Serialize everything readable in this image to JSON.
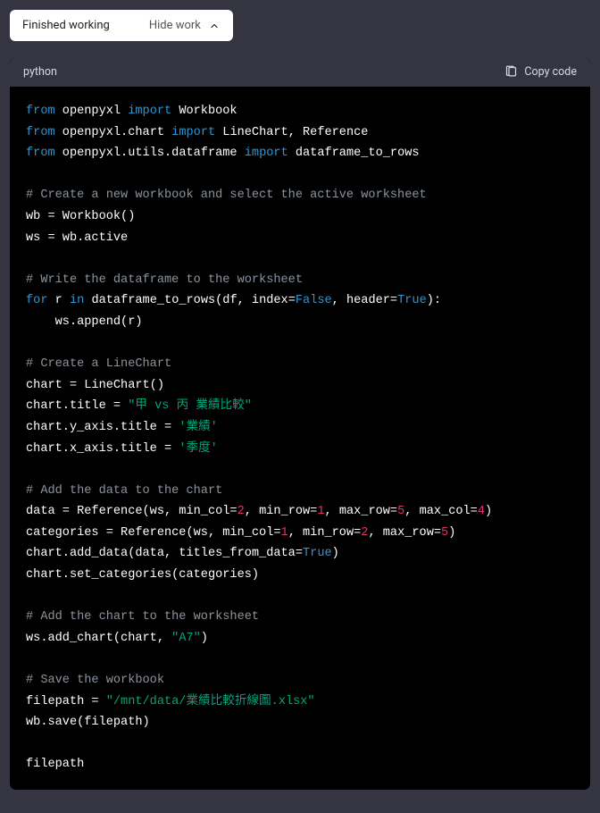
{
  "pill": {
    "status": "Finished working",
    "hide": "Hide work"
  },
  "header": {
    "language": "python",
    "copy": "Copy code"
  },
  "c": {
    "l1_from": "from",
    "l1_mod": " openpyxl ",
    "l1_imp": "import",
    "l1_rest": " Workbook",
    "l2_from": "from",
    "l2_mod": " openpyxl.chart ",
    "l2_imp": "import",
    "l2_rest": " LineChart, Reference",
    "l3_from": "from",
    "l3_mod": " openpyxl.utils.dataframe ",
    "l3_imp": "import",
    "l3_rest": " dataframe_to_rows",
    "blank": "",
    "cmt1": "# Create a new workbook and select the active worksheet",
    "l5": "wb = Workbook()",
    "l6": "ws = wb.active",
    "cmt2": "# Write the dataframe to the worksheet",
    "l8_for": "for",
    "l8_a": " r ",
    "l8_in": "in",
    "l8_b": " dataframe_to_rows(df, index=",
    "l8_false": "False",
    "l8_c": ", header=",
    "l8_true": "True",
    "l8_d": "):",
    "l9": "    ws.append(r)",
    "cmt3": "# Create a LineChart",
    "l11": "chart = LineChart()",
    "l12_a": "chart.title = ",
    "l12_s": "\"甲 vs 丙 業績比較\"",
    "l13_a": "chart.y_axis.title = ",
    "l13_s": "'業績'",
    "l14_a": "chart.x_axis.title = ",
    "l14_s": "'季度'",
    "cmt4": "# Add the data to the chart",
    "l16_a": "data = Reference(ws, min_col=",
    "l16_n1": "2",
    "l16_b": ", min_row=",
    "l16_n2": "1",
    "l16_c": ", max_row=",
    "l16_n3": "5",
    "l16_d": ", max_col=",
    "l16_n4": "4",
    "l16_e": ")",
    "l17_a": "categories = Reference(ws, min_col=",
    "l17_n1": "1",
    "l17_b": ", min_row=",
    "l17_n2": "2",
    "l17_c": ", max_row=",
    "l17_n3": "5",
    "l17_d": ")",
    "l18_a": "chart.add_data(data, titles_from_data=",
    "l18_true": "True",
    "l18_b": ")",
    "l19": "chart.set_categories(categories)",
    "cmt5": "# Add the chart to the worksheet",
    "l21_a": "ws.add_chart(chart, ",
    "l21_s": "\"A7\"",
    "l21_b": ")",
    "cmt6": "# Save the workbook",
    "l23_a": "filepath = ",
    "l23_s": "\"/mnt/data/業績比較折線圖.xlsx\"",
    "l24": "wb.save(filepath)",
    "l26": "filepath"
  }
}
